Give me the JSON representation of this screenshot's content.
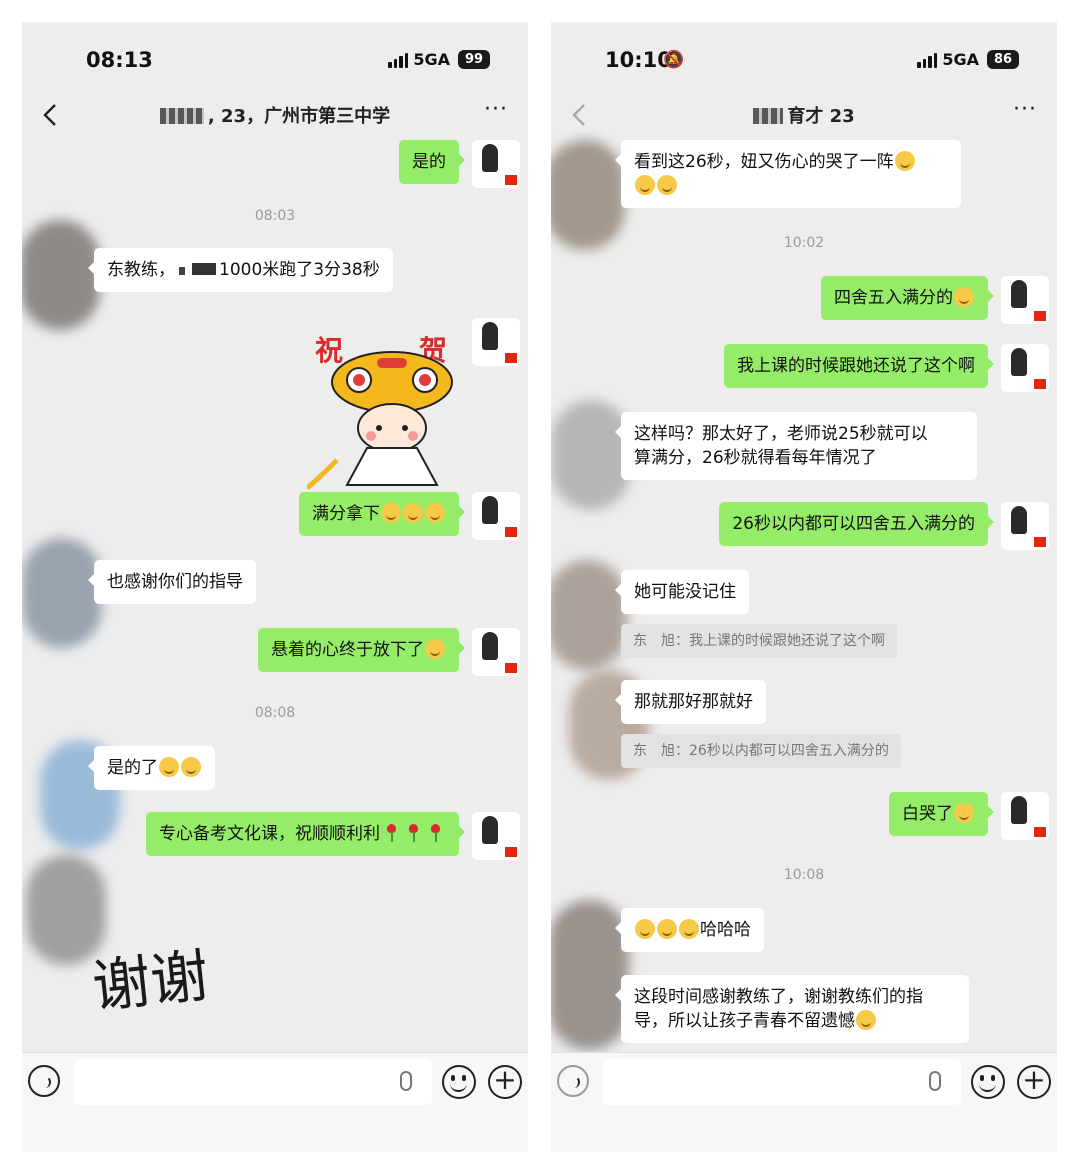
{
  "left": {
    "status": {
      "time": "08:13",
      "network": "5GA",
      "battery": "99"
    },
    "title": ", 23，广州市第三中学",
    "messages": {
      "m1": "是的",
      "t1": "08:03",
      "m2a": "东教练，",
      "m2b": "1000米跑了3分38秒",
      "sticker_text_1": "祝",
      "sticker_text_2": "贺",
      "m3": "满分拿下",
      "m4": "也感谢你们的指导",
      "m5": "悬着的心终于放下了",
      "t2": "08:08",
      "m6": "是的了",
      "m7": "专心备考文化课，祝顺顺利利",
      "m8": "谢谢"
    }
  },
  "right": {
    "status": {
      "time": "10:10",
      "network": "5GA",
      "battery": "86"
    },
    "title": "育才 23",
    "messages": {
      "m1a": "看到这26秒，妞又伤心的哭了一阵",
      "t1": "10:02",
      "m2": "四舍五入满分的",
      "m3": "我上课的时候跟她还说了这个啊",
      "m4a": "这样吗？那太好了，老师说25秒就可以",
      "m4b": "算满分，26秒就得看每年情况了",
      "m5": "26秒以内都可以四舍五入满分的",
      "m6": "她可能没记住",
      "q1": "东　旭：我上课的时候跟她还说了这个啊",
      "m7": "那就那好那就好",
      "q2": "东　旭：26秒以内都可以四舍五入满分的",
      "m8": "白哭了",
      "t2": "10:08",
      "m9": "哈哈哈",
      "m10a": "这段时间感谢教练了，谢谢教练们的指",
      "m10b": "导，所以让孩子青春不留遗憾"
    }
  },
  "colors": {
    "out_bubble": "#95ec69",
    "in_bubble": "#ffffff",
    "chat_bg": "#ededed"
  }
}
